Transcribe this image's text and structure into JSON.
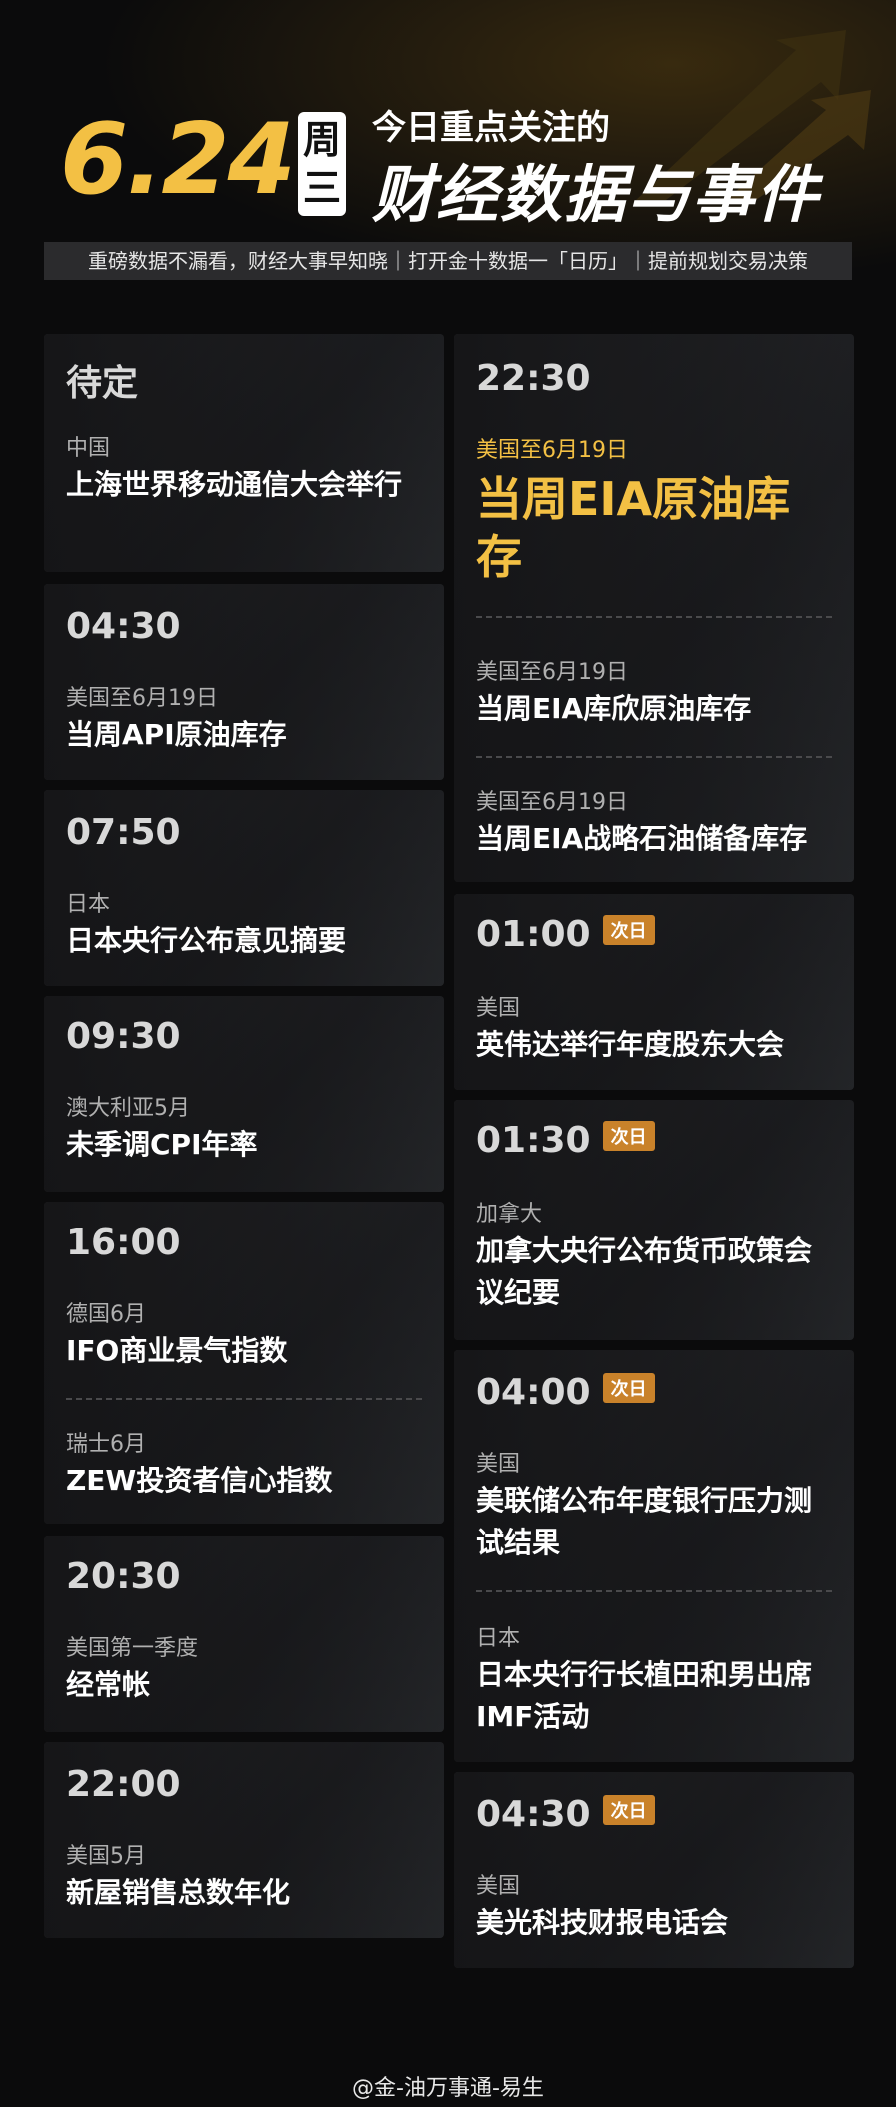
{
  "header": {
    "date": "6.24",
    "weekday": [
      "周",
      "三"
    ],
    "headline_small": "今日重点关注的",
    "headline_big": "财经数据与事件",
    "tagline": "重磅数据不漏看，财经大事早知晓｜打开金十数据一「日历」｜提前规划交易决策"
  },
  "left_cards": [
    {
      "time": "待定",
      "items": [
        {
          "region": "中国",
          "event": "上海世界移动通信大会举行"
        }
      ]
    },
    {
      "time": "04:30",
      "items": [
        {
          "region": "美国至6月19日",
          "event": "当周API原油库存"
        }
      ]
    },
    {
      "time": "07:50",
      "items": [
        {
          "region": "日本",
          "event": "日本央行公布意见摘要"
        }
      ]
    },
    {
      "time": "09:30",
      "items": [
        {
          "region": "澳大利亚5月",
          "event": "未季调CPI年率"
        }
      ]
    },
    {
      "time": "16:00",
      "items": [
        {
          "region": "德国6月",
          "event": "IFO商业景气指数"
        },
        {
          "region": "瑞士6月",
          "event": "ZEW投资者信心指数"
        }
      ]
    },
    {
      "time": "20:30",
      "items": [
        {
          "region": "美国第一季度",
          "event": "经常帐"
        }
      ]
    },
    {
      "time": "22:00",
      "items": [
        {
          "region": "美国5月",
          "event": "新屋销售总数年化"
        }
      ]
    }
  ],
  "right_cards": [
    {
      "time": "22:30",
      "items": [
        {
          "region": "美国至6月19日",
          "event": "当周EIA原油库存"
        },
        {
          "region": "美国至6月19日",
          "event": "当周EIA库欣原油库存"
        },
        {
          "region": "美国至6月19日",
          "event": "当周EIA战略石油储备库存"
        }
      ]
    },
    {
      "time": "01:00",
      "badge": "次日",
      "items": [
        {
          "region": "美国",
          "event": "英伟达举行年度股东大会"
        }
      ]
    },
    {
      "time": "01:30",
      "badge": "次日",
      "items": [
        {
          "region": "加拿大",
          "event": "加拿大央行公布货币政策会议纪要"
        }
      ]
    },
    {
      "time": "04:00",
      "badge": "次日",
      "items": [
        {
          "region": "美国",
          "event": "美联储公布年度银行压力测试结果"
        },
        {
          "region": "日本",
          "event": "日本央行行长植田和男出席IMF活动"
        }
      ]
    },
    {
      "time": "04:30",
      "badge": "次日",
      "items": [
        {
          "region": "美国",
          "event": "美光科技财报电话会"
        }
      ]
    }
  ],
  "footer": {
    "text": "@金-油万事通-易生"
  },
  "colors": {
    "accent": "#f3c044",
    "badge": "#c9822a",
    "background": "#0b0b0c"
  }
}
